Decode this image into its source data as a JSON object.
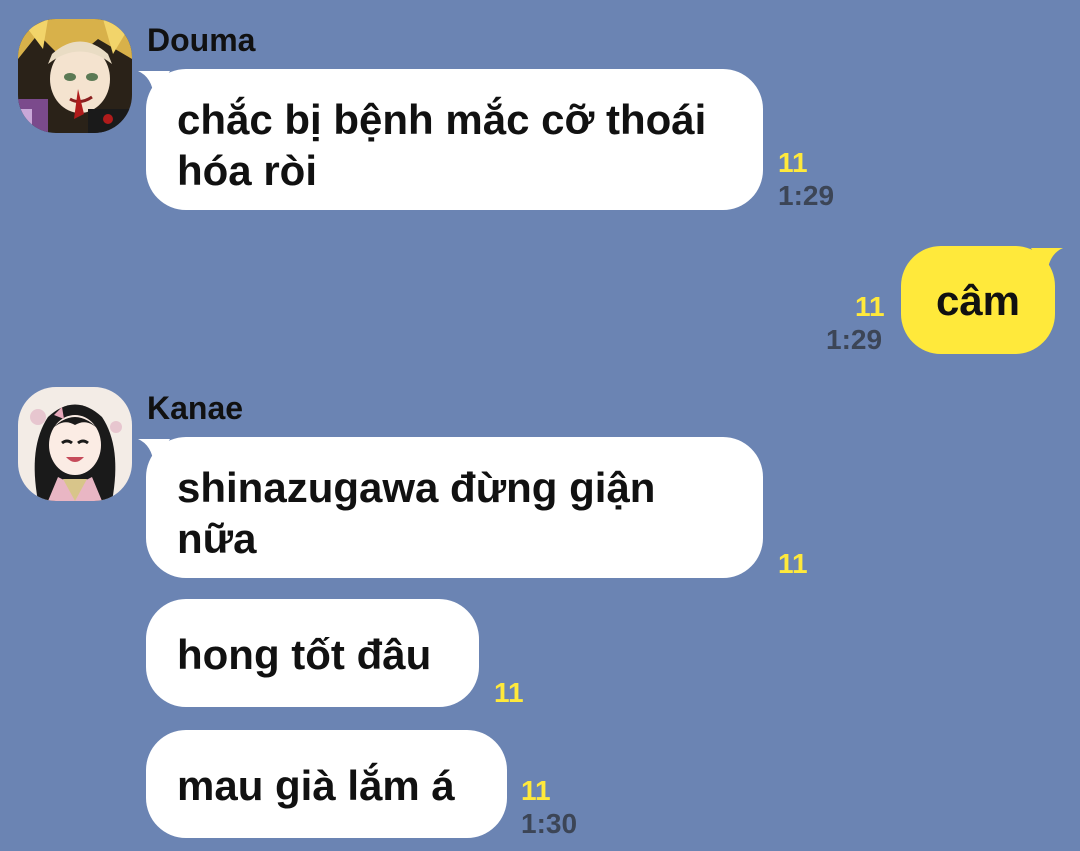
{
  "messages": [
    {
      "sender": "Douma",
      "text": "chắc bị bệnh mắc cỡ thoái hóa ròi",
      "read": "11",
      "time": "1:29"
    },
    {
      "sender": "",
      "text": "câm",
      "read": "11",
      "time": "1:29"
    },
    {
      "sender": "Kanae",
      "text": "shinazugawa đừng giận nữa",
      "read": "11",
      "time": ""
    },
    {
      "sender": "",
      "text": "hong tốt đâu",
      "read": "11",
      "time": ""
    },
    {
      "sender": "",
      "text": "mau già lắm á",
      "read": "11",
      "time": "1:30"
    }
  ],
  "colors": {
    "background": "#6b84b3",
    "incoming_bubble": "#ffffff",
    "outgoing_bubble": "#ffe93b",
    "read_count": "#ffe93b",
    "timestamp": "#3c4556"
  }
}
